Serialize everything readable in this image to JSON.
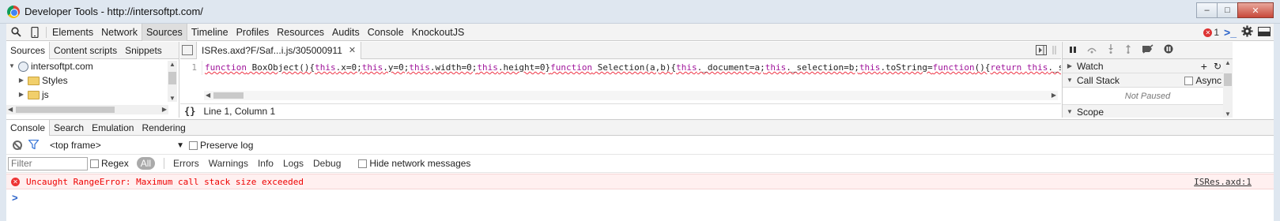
{
  "window": {
    "title": "Developer Tools - http://intersoftpt.com/",
    "controls": [
      "–",
      "□",
      "✕"
    ]
  },
  "toolbar": {
    "tabs": [
      "Elements",
      "Network",
      "Sources",
      "Timeline",
      "Profiles",
      "Resources",
      "Audits",
      "Console",
      "KnockoutJS"
    ],
    "active_tab": "Sources",
    "error_count": "1",
    "prompt_glyph": ">_"
  },
  "navigator": {
    "tabs": [
      "Sources",
      "Content scripts",
      "Snippets"
    ],
    "tree": [
      {
        "label": "intersoftpt.com",
        "type": "domain"
      },
      {
        "label": "Styles",
        "type": "folder"
      },
      {
        "label": "js",
        "type": "folder"
      }
    ]
  },
  "editor": {
    "file_tab": "ISRes.axd?F/Saf...i.js/305000911",
    "line_number": "1",
    "code_segments": [
      {
        "t": "function",
        "kw": true
      },
      {
        "t": " BoxObject(){",
        "kw": false
      },
      {
        "t": "this",
        "kw": true
      },
      {
        "t": ".x=0;",
        "kw": false
      },
      {
        "t": "this",
        "kw": true
      },
      {
        "t": ".y=0;",
        "kw": false
      },
      {
        "t": "this",
        "kw": true
      },
      {
        "t": ".width=0;",
        "kw": false
      },
      {
        "t": "this",
        "kw": true
      },
      {
        "t": ".height=0}",
        "kw": false
      },
      {
        "t": "function",
        "kw": true
      },
      {
        "t": " Selection(a,b){",
        "kw": false
      },
      {
        "t": "this",
        "kw": true
      },
      {
        "t": "._document=a;",
        "kw": false
      },
      {
        "t": "this",
        "kw": true
      },
      {
        "t": "._selection=b;",
        "kw": false
      },
      {
        "t": "this",
        "kw": true
      },
      {
        "t": ".toString=",
        "kw": false
      },
      {
        "t": "function",
        "kw": true
      },
      {
        "t": "(){",
        "kw": false
      },
      {
        "t": "return",
        "kw": true
      },
      {
        "t": " ",
        "kw": false
      },
      {
        "t": "this",
        "kw": true
      },
      {
        "t": "._selecti",
        "kw": false
      }
    ],
    "status": "Line 1, Column 1",
    "braces": "{}"
  },
  "debugger": {
    "sections": {
      "watch": "Watch",
      "call_stack": "Call Stack",
      "async": "Async",
      "not_paused": "Not Paused",
      "scope": "Scope"
    }
  },
  "drawer": {
    "tabs": [
      "Console",
      "Search",
      "Emulation",
      "Rendering"
    ],
    "active_tab": "Console",
    "frame": "<top frame>",
    "preserve_log": "Preserve log",
    "filter_placeholder": "Filter",
    "regex": "Regex",
    "all": "All",
    "levels": [
      "Errors",
      "Warnings",
      "Info",
      "Logs",
      "Debug"
    ],
    "hide_network": "Hide network messages",
    "error_message": "Uncaught RangeError: Maximum call stack size exceeded",
    "error_source": "ISRes.axd:1",
    "prompt": ">"
  }
}
